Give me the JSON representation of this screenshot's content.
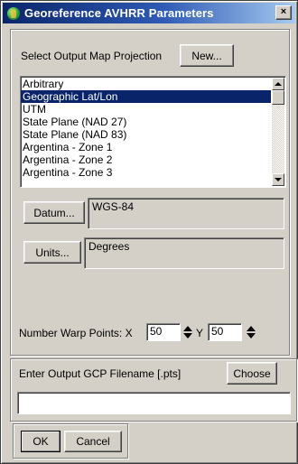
{
  "window": {
    "title": "Georeference AVHRR Parameters",
    "close_glyph": "×",
    "app_icon": "globe-icon"
  },
  "projection": {
    "label": "Select Output Map Projection",
    "new_button": "New...",
    "items": [
      "Arbitrary",
      "Geographic Lat/Lon",
      "UTM",
      "State Plane (NAD 27)",
      "State Plane (NAD 83)",
      "Argentina - Zone 1",
      "Argentina - Zone 2",
      "Argentina - Zone 3"
    ],
    "selected_index": 1
  },
  "datum": {
    "button": "Datum...",
    "value": "WGS-84"
  },
  "units": {
    "button": "Units...",
    "value": "Degrees"
  },
  "warp": {
    "label": "Number Warp Points: X",
    "x_value": "50",
    "y_label": "Y",
    "y_value": "50"
  },
  "gcp": {
    "label": "Enter Output GCP Filename [.pts]",
    "choose_button": "Choose",
    "filename": ""
  },
  "footer": {
    "ok_button": "OK",
    "cancel_button": "Cancel"
  },
  "colors": {
    "face": "#d4d0c8",
    "title_start": "#0a246a",
    "title_end": "#a6caf0",
    "selection": "#0a246a"
  }
}
